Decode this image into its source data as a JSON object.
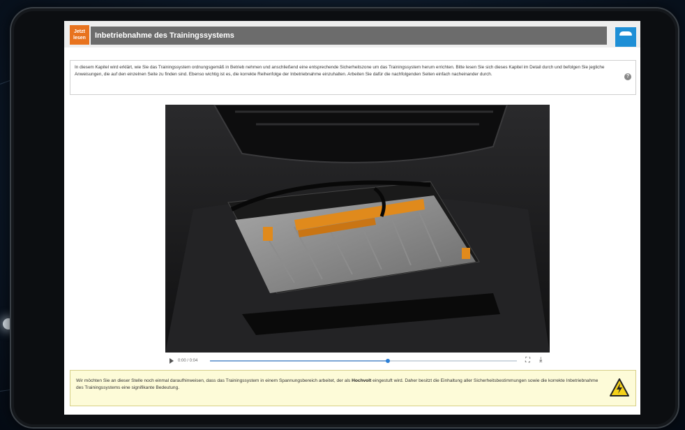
{
  "window": {
    "title": "Inbetriebnahme des Trainingssystems",
    "logo_text_1": "Jetzt",
    "logo_text_2": "lesen"
  },
  "intro": {
    "text": "In diesem Kapitel wird erklärt, wie Sie das Trainingssystem ordnungsgemäß in Betrieb nehmen und anschließend eine entsprechende Sicherheitszone um das Trainingssystem herum errichten. Bitte lesen Sie sich dieses Kapitel im Detail durch und befolgen Sie jegliche Anweisungen, die auf den einzelnen Seite zu finden sind. Ebenso wichtig ist es, die korrekte Reihenfolge der Inbetriebnahme einzuhalten. Arbeiten Sie dafür die nachfolgenden Seiten einfach nacheinander durch."
  },
  "video": {
    "time_display": "0:00 / 0:04",
    "progress": 0.58
  },
  "warning": {
    "text_before": "Wir möchten Sie an dieser Stelle noch einmal daraufhinweisen, dass das Trainingssystem in einem Spannungsbereich arbeitet, der als ",
    "bold": "Hochvolt",
    "text_after": " eingestuft wird. Daher besitzt die Einhaltung aller Sicherheitsbestimmungen sowie die korrekte Inbetriebnahme des Trainingssystems eine signifikante Bedeutung."
  },
  "icons": {
    "play": "play-icon",
    "fullscreen": "fullscreen-icon",
    "download": "download-icon",
    "help": "help-icon",
    "warning": "high-voltage-warning-icon",
    "brand": "car-brand-icon"
  },
  "colors": {
    "accent_orange": "#e8731e",
    "title_bar": "#6c6c6c",
    "brand_blue": "#1e8fd6",
    "warning_bg": "#fdfbd8"
  }
}
